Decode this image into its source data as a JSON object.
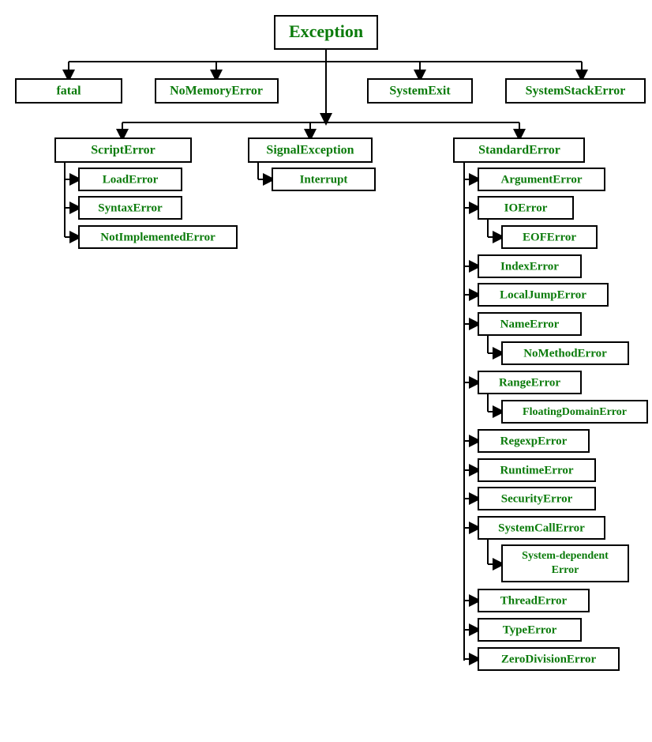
{
  "colors": {
    "text": "#0b7b0b",
    "border": "#000000",
    "background": "#ffffff"
  },
  "root": "Exception",
  "level1": {
    "fatal": "fatal",
    "noMemory": "NoMemoryError",
    "systemExit": "SystemExit",
    "systemStack": "SystemStackError"
  },
  "level2": {
    "scriptError": "ScriptError",
    "signalException": "SignalException",
    "standardError": "StandardError"
  },
  "scriptErrorChildren": {
    "loadError": "LoadError",
    "syntaxError": "SyntaxError",
    "notImplemented": "NotImplementedError"
  },
  "signalChildren": {
    "interrupt": "Interrupt"
  },
  "standardErrorChildren": {
    "argumentError": "ArgumentError",
    "ioError": "IOError",
    "ioErrorChild": "EOFError",
    "indexError": "IndexError",
    "localJump": "LocalJumpError",
    "nameError": "NameError",
    "nameErrorChild": "NoMethodError",
    "rangeError": "RangeError",
    "rangeErrorChild": "FloatingDomainError",
    "regexp": "RegexpError",
    "runtime": "RuntimeError",
    "security": "SecurityError",
    "systemCall": "SystemCallError",
    "systemCallChild1": "System-dependent",
    "systemCallChild2": "Error",
    "threadError": "ThreadError",
    "typeError": "TypeError",
    "zeroDiv": "ZeroDivisionError"
  }
}
